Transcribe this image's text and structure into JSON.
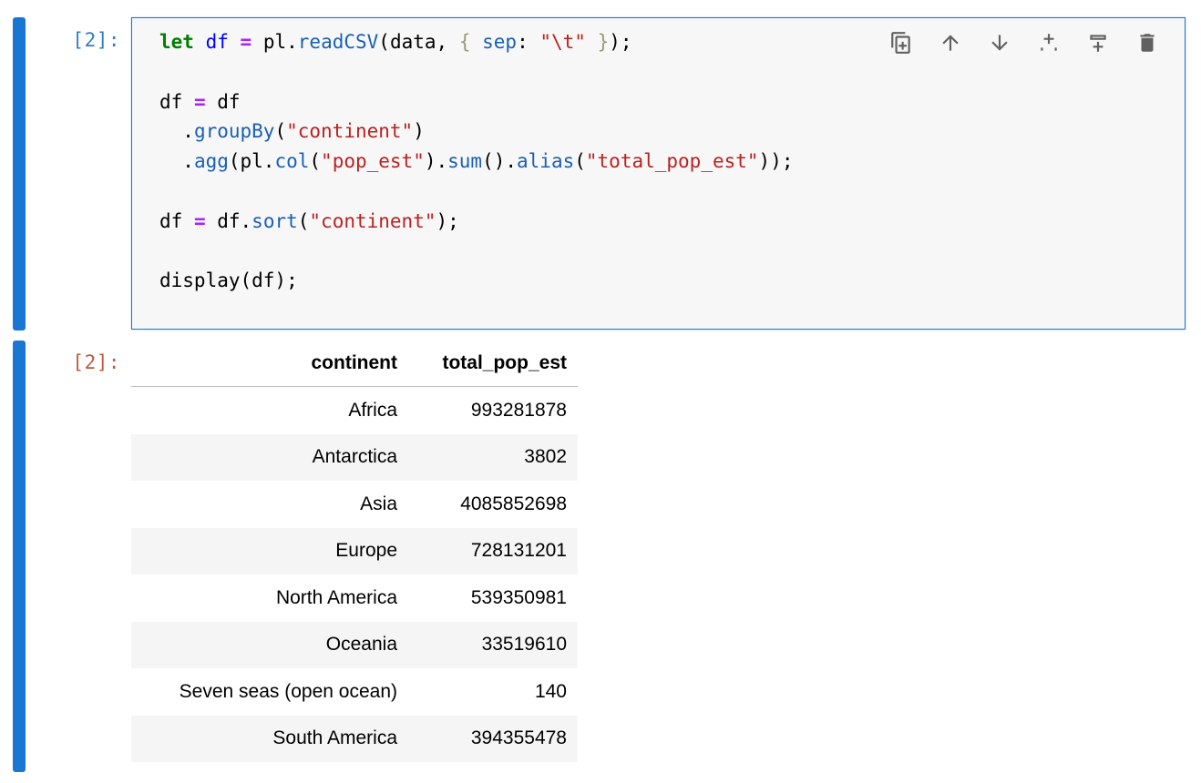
{
  "input_cell": {
    "prompt": "[2]:",
    "code_lines": [
      [
        {
          "t": "let",
          "c": "kw"
        },
        {
          "t": " ",
          "c": "plain"
        },
        {
          "t": "df",
          "c": "def"
        },
        {
          "t": " ",
          "c": "plain"
        },
        {
          "t": "=",
          "c": "op"
        },
        {
          "t": " pl.",
          "c": "plain"
        },
        {
          "t": "readCSV",
          "c": "prop"
        },
        {
          "t": "(data, ",
          "c": "plain"
        },
        {
          "t": "{",
          "c": "brace"
        },
        {
          "t": " ",
          "c": "plain"
        },
        {
          "t": "sep",
          "c": "prop"
        },
        {
          "t": ": ",
          "c": "plain"
        },
        {
          "t": "\"\\t\"",
          "c": "str"
        },
        {
          "t": " ",
          "c": "plain"
        },
        {
          "t": "}",
          "c": "brace"
        },
        {
          "t": ");",
          "c": "plain"
        }
      ],
      [],
      [
        {
          "t": "df ",
          "c": "plain"
        },
        {
          "t": "=",
          "c": "op"
        },
        {
          "t": " df",
          "c": "plain"
        }
      ],
      [
        {
          "t": "  .",
          "c": "plain"
        },
        {
          "t": "groupBy",
          "c": "prop"
        },
        {
          "t": "(",
          "c": "plain"
        },
        {
          "t": "\"continent\"",
          "c": "str"
        },
        {
          "t": ")",
          "c": "plain"
        }
      ],
      [
        {
          "t": "  .",
          "c": "plain"
        },
        {
          "t": "agg",
          "c": "prop"
        },
        {
          "t": "(pl.",
          "c": "plain"
        },
        {
          "t": "col",
          "c": "prop"
        },
        {
          "t": "(",
          "c": "plain"
        },
        {
          "t": "\"pop_est\"",
          "c": "str"
        },
        {
          "t": ").",
          "c": "plain"
        },
        {
          "t": "sum",
          "c": "prop"
        },
        {
          "t": "().",
          "c": "plain"
        },
        {
          "t": "alias",
          "c": "prop"
        },
        {
          "t": "(",
          "c": "plain"
        },
        {
          "t": "\"total_pop_est\"",
          "c": "str"
        },
        {
          "t": "));",
          "c": "plain"
        }
      ],
      [],
      [
        {
          "t": "df ",
          "c": "plain"
        },
        {
          "t": "=",
          "c": "op"
        },
        {
          "t": " df.",
          "c": "plain"
        },
        {
          "t": "sort",
          "c": "prop"
        },
        {
          "t": "(",
          "c": "plain"
        },
        {
          "t": "\"continent\"",
          "c": "str"
        },
        {
          "t": ");",
          "c": "plain"
        }
      ],
      [],
      [
        {
          "t": "display(df);",
          "c": "plain"
        }
      ]
    ],
    "toolbar": [
      {
        "name": "duplicate-cell-button",
        "icon": "duplicate-icon"
      },
      {
        "name": "move-up-button",
        "icon": "arrow-up-icon"
      },
      {
        "name": "move-down-button",
        "icon": "arrow-down-icon"
      },
      {
        "name": "insert-above-button",
        "icon": "insert-above-icon"
      },
      {
        "name": "insert-below-button",
        "icon": "insert-below-icon"
      },
      {
        "name": "delete-cell-button",
        "icon": "trash-icon"
      }
    ]
  },
  "output_cell": {
    "prompt": "[2]:",
    "table": {
      "columns": [
        "continent",
        "total_pop_est"
      ],
      "rows": [
        [
          "Africa",
          "993281878"
        ],
        [
          "Antarctica",
          "3802"
        ],
        [
          "Asia",
          "4085852698"
        ],
        [
          "Europe",
          "728131201"
        ],
        [
          "North America",
          "539350981"
        ],
        [
          "Oceania",
          "33519610"
        ],
        [
          "Seven seas (open ocean)",
          "140"
        ],
        [
          "South America",
          "394355478"
        ]
      ]
    }
  },
  "colors": {
    "collapser": "#1976d2",
    "prompt_in": "#307fc1",
    "prompt_out": "#bf5b3d"
  }
}
